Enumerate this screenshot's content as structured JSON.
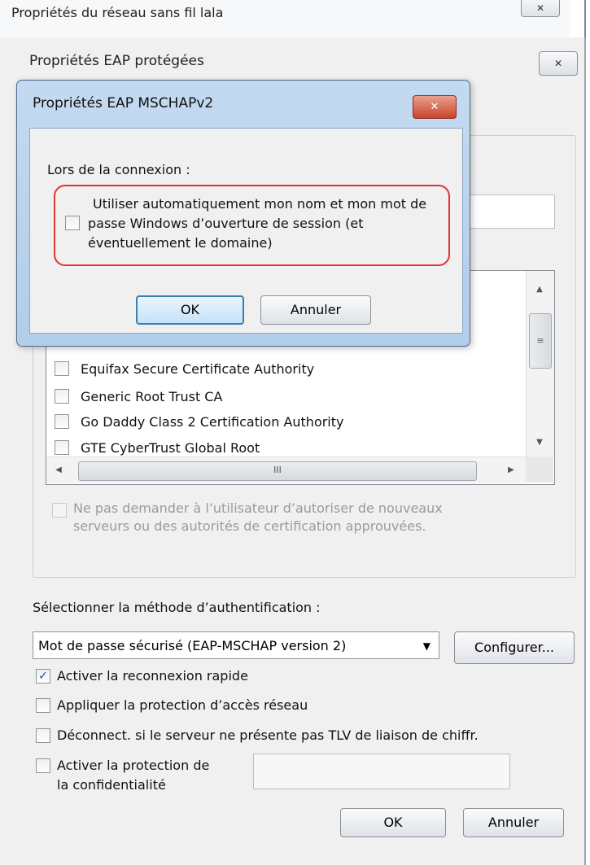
{
  "back_window": {
    "title": "Propriétés du réseau sans fil lala",
    "close_icon": "✕"
  },
  "eap_window": {
    "title": "Propriétés EAP protégées",
    "close_icon": "✕",
    "cert_list": [
      "Equifax Secure Certificate Authority",
      "Generic Root Trust CA",
      "Go Daddy Class 2 Certification Authority",
      "GTE CyberTrust Global Root"
    ],
    "scroll_grip": "≡",
    "hscroll_grip": "III",
    "no_prompt_line1": "Ne pas demander à l’utilisateur d’autoriser de nouveaux",
    "no_prompt_line2": "serveurs ou des autorités de certification approuvées.",
    "auth_label": "Sélectionner la méthode d’authentification :",
    "auth_method": "Mot de passe sécurisé (EAP-MSCHAP version 2)",
    "configure_label": "Configurer...",
    "fast_reconnect": "Activer la reconnexion rapide",
    "fast_reconnect_checked": true,
    "nap": "Appliquer la protection d’accès réseau",
    "disconnect": "Déconnect. si le serveur ne présente pas TLV de liaison de chiffr.",
    "privacy_line1": "Activer la protection de",
    "privacy_line2": "la confidentialité",
    "ok_label": "OK",
    "cancel_label": "Annuler"
  },
  "mschap_dialog": {
    "title": "Propriétés EAP MSCHAPv2",
    "close_icon": "✕",
    "connection_label": "Lors de la connexion :",
    "auto_line1": "Utiliser automatiquement mon nom et mon mot de",
    "auto_line2": "passe Windows d’ouverture de session (et",
    "auto_line3": "éventuellement le domaine)",
    "auto_checked": false,
    "ok_label": "OK",
    "cancel_label": "Annuler",
    "highlight_color": "#e23333"
  },
  "icons": {
    "arrow_up": "▲",
    "arrow_down": "▼",
    "arrow_left": "◀",
    "arrow_right": "▶",
    "dropdown": "▼",
    "check": "✓"
  }
}
